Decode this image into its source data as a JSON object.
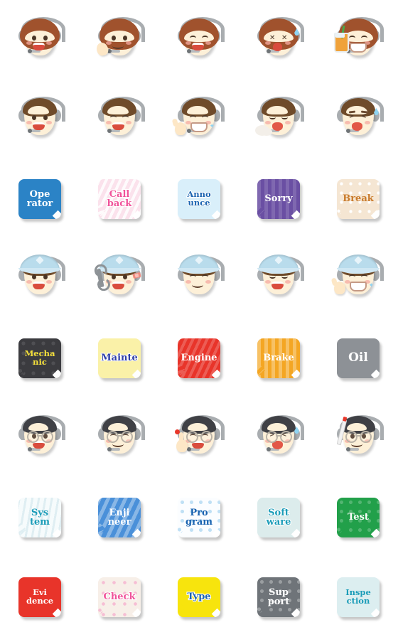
{
  "sheet": {
    "title": "Operator / Mechanic / Engineer Emoji Sticker Sheet",
    "columns": 5,
    "rows": 8,
    "background": "#ffffff"
  },
  "rows": [
    {
      "kind": "face",
      "group": "female-operator",
      "items": [
        {
          "name": "female-operator-smile",
          "expression": "open smile",
          "props": []
        },
        {
          "name": "female-operator-wave",
          "expression": "waving hand",
          "props": [
            "hand"
          ]
        },
        {
          "name": "female-operator-laugh",
          "expression": "laughing",
          "props": []
        },
        {
          "name": "female-operator-dizzy",
          "expression": "dizzy x-eyes with sweat",
          "props": [
            "sweat"
          ]
        },
        {
          "name": "female-operator-drink",
          "expression": "happy with drink",
          "props": [
            "drink"
          ]
        }
      ]
    },
    {
      "kind": "face",
      "group": "male-operator",
      "items": [
        {
          "name": "male-operator-smile",
          "expression": "open smile",
          "props": []
        },
        {
          "name": "male-operator-laugh",
          "expression": "laughing",
          "props": []
        },
        {
          "name": "male-operator-thumbsup",
          "expression": "grin with thumbs up",
          "props": [
            "hand",
            "shine"
          ]
        },
        {
          "name": "male-operator-yawn",
          "expression": "sleepy yawn with breath",
          "props": [
            "breath"
          ]
        },
        {
          "name": "male-operator-cry",
          "expression": "distressed crying with sweat",
          "props": [
            "sweat"
          ]
        }
      ]
    },
    {
      "kind": "badge",
      "group": "operator-words",
      "items": [
        {
          "name": "badge-operator",
          "lines": [
            "Ope",
            "rator"
          ],
          "bg": "#2b83c6",
          "fg": "#ffffff",
          "pattern": "plain",
          "size": "s2",
          "outline": "none"
        },
        {
          "name": "badge-callback",
          "lines": [
            "Call",
            "back"
          ],
          "bg": "#fbe2ec",
          "fg": "#f0529a",
          "pattern": "stripe-pink",
          "size": "s2",
          "outline": "white"
        },
        {
          "name": "badge-announce",
          "lines": [
            "Anno",
            "unce"
          ],
          "bg": "#d9effa",
          "fg": "#1a63b0",
          "pattern": "plain",
          "size": "s3",
          "outline": "white"
        },
        {
          "name": "badge-sorry",
          "lines": [
            "Sorry"
          ],
          "bg": "#6a4fa3",
          "fg": "#ffffff",
          "pattern": "stripe-purple",
          "size": "s2",
          "outline": "none"
        },
        {
          "name": "badge-break",
          "lines": [
            "Break"
          ],
          "bg": "#f5e6d3",
          "fg": "#c97b2c",
          "pattern": "dots-white",
          "size": "s2",
          "outline": "none"
        }
      ]
    },
    {
      "kind": "face",
      "group": "mechanic",
      "items": [
        {
          "name": "mechanic-smile",
          "expression": "open smile",
          "props": []
        },
        {
          "name": "mechanic-wrench",
          "expression": "holding wrench with bandage",
          "props": [
            "wrench",
            "bandage"
          ]
        },
        {
          "name": "mechanic-happy",
          "expression": "closed-eye smile",
          "props": []
        },
        {
          "name": "mechanic-laugh",
          "expression": "laughing",
          "props": []
        },
        {
          "name": "mechanic-thumbsup",
          "expression": "wink grin with thumbs up",
          "props": [
            "hand",
            "shine"
          ]
        }
      ]
    },
    {
      "kind": "badge",
      "group": "mechanic-words",
      "items": [
        {
          "name": "badge-mechanic",
          "lines": [
            "Mecha",
            "nic"
          ],
          "bg": "#3b3b3f",
          "fg": "#f5e03a",
          "pattern": "stars-dark",
          "size": "s3",
          "outline": "none"
        },
        {
          "name": "badge-mainte",
          "lines": [
            "Mainte"
          ],
          "bg": "#faf1a8",
          "fg": "#2f3fa8",
          "pattern": "plain",
          "size": "s2",
          "outline": "white"
        },
        {
          "name": "badge-engine",
          "lines": [
            "Engine"
          ],
          "bg": "#e8342a",
          "fg": "#ffffff",
          "pattern": "stripe-red",
          "size": "s2",
          "outline": "none"
        },
        {
          "name": "badge-brake",
          "lines": [
            "Brake"
          ],
          "bg": "#f4a623",
          "fg": "#ffffff",
          "pattern": "stripe-orange",
          "size": "s2",
          "outline": "none"
        },
        {
          "name": "badge-oil",
          "lines": [
            "Oil"
          ],
          "bg": "#8d9196",
          "fg": "#ffffff",
          "pattern": "plain",
          "size": "s4",
          "outline": "none"
        }
      ]
    },
    {
      "kind": "face",
      "group": "engineer",
      "items": [
        {
          "name": "engineer-smile",
          "expression": "open smile with glasses",
          "props": []
        },
        {
          "name": "engineer-happy",
          "expression": "closed-eye smile",
          "props": []
        },
        {
          "name": "engineer-idea",
          "expression": "wink with raised finger and idea mark",
          "props": [
            "hand",
            "idea"
          ]
        },
        {
          "name": "engineer-upset",
          "expression": "distressed with sweat",
          "props": [
            "sweat"
          ]
        },
        {
          "name": "engineer-pointer",
          "expression": "holding pointer stick",
          "props": [
            "pointer"
          ]
        }
      ]
    },
    {
      "kind": "badge",
      "group": "engineer-words",
      "items": [
        {
          "name": "badge-system",
          "lines": [
            "Sys",
            "tem"
          ],
          "bg": "#f6fbfc",
          "fg": "#1b9cb8",
          "pattern": "stripe-white",
          "size": "s2",
          "outline": "none"
        },
        {
          "name": "badge-enjineer",
          "lines": [
            "Enji",
            "neer"
          ],
          "bg": "#4a90d9",
          "fg": "#ffffff",
          "pattern": "stripe-blue",
          "size": "s2",
          "outline": "none"
        },
        {
          "name": "badge-program",
          "lines": [
            "Pro",
            "gram"
          ],
          "bg": "#fbfdff",
          "fg": "#1a63b0",
          "pattern": "dots-blue",
          "size": "s2",
          "outline": "none"
        },
        {
          "name": "badge-software",
          "lines": [
            "Soft",
            "ware"
          ],
          "bg": "#dcecec",
          "fg": "#1b9cb8",
          "pattern": "plain",
          "size": "s2",
          "outline": "white"
        },
        {
          "name": "badge-test",
          "lines": [
            "Test"
          ],
          "bg": "#22a04a",
          "fg": "#ffffff",
          "pattern": "stars-green",
          "size": "s2",
          "outline": "none"
        }
      ]
    },
    {
      "kind": "badge",
      "group": "check-words",
      "items": [
        {
          "name": "badge-evidence",
          "lines": [
            "Evi",
            "dence"
          ],
          "bg": "#e8342a",
          "fg": "#ffffff",
          "pattern": "plain",
          "size": "s3",
          "outline": "none"
        },
        {
          "name": "badge-check",
          "lines": [
            "Check"
          ],
          "bg": "#f7efe8",
          "fg": "#f0529a",
          "pattern": "stars-pink",
          "size": "s2",
          "outline": "white"
        },
        {
          "name": "badge-type",
          "lines": [
            "Type"
          ],
          "bg": "#f7e40d",
          "fg": "#1a63b0",
          "pattern": "plain",
          "size": "s2",
          "outline": "white"
        },
        {
          "name": "badge-support",
          "lines": [
            "Sup",
            "port"
          ],
          "bg": "#6f7479",
          "fg": "#ffffff",
          "pattern": "dots-gray",
          "size": "s2",
          "outline": "none"
        },
        {
          "name": "badge-inspection",
          "lines": [
            "Inspe",
            "ction"
          ],
          "bg": "#dceef0",
          "fg": "#1b9cb8",
          "pattern": "plain",
          "size": "s3",
          "outline": "none"
        }
      ]
    }
  ]
}
